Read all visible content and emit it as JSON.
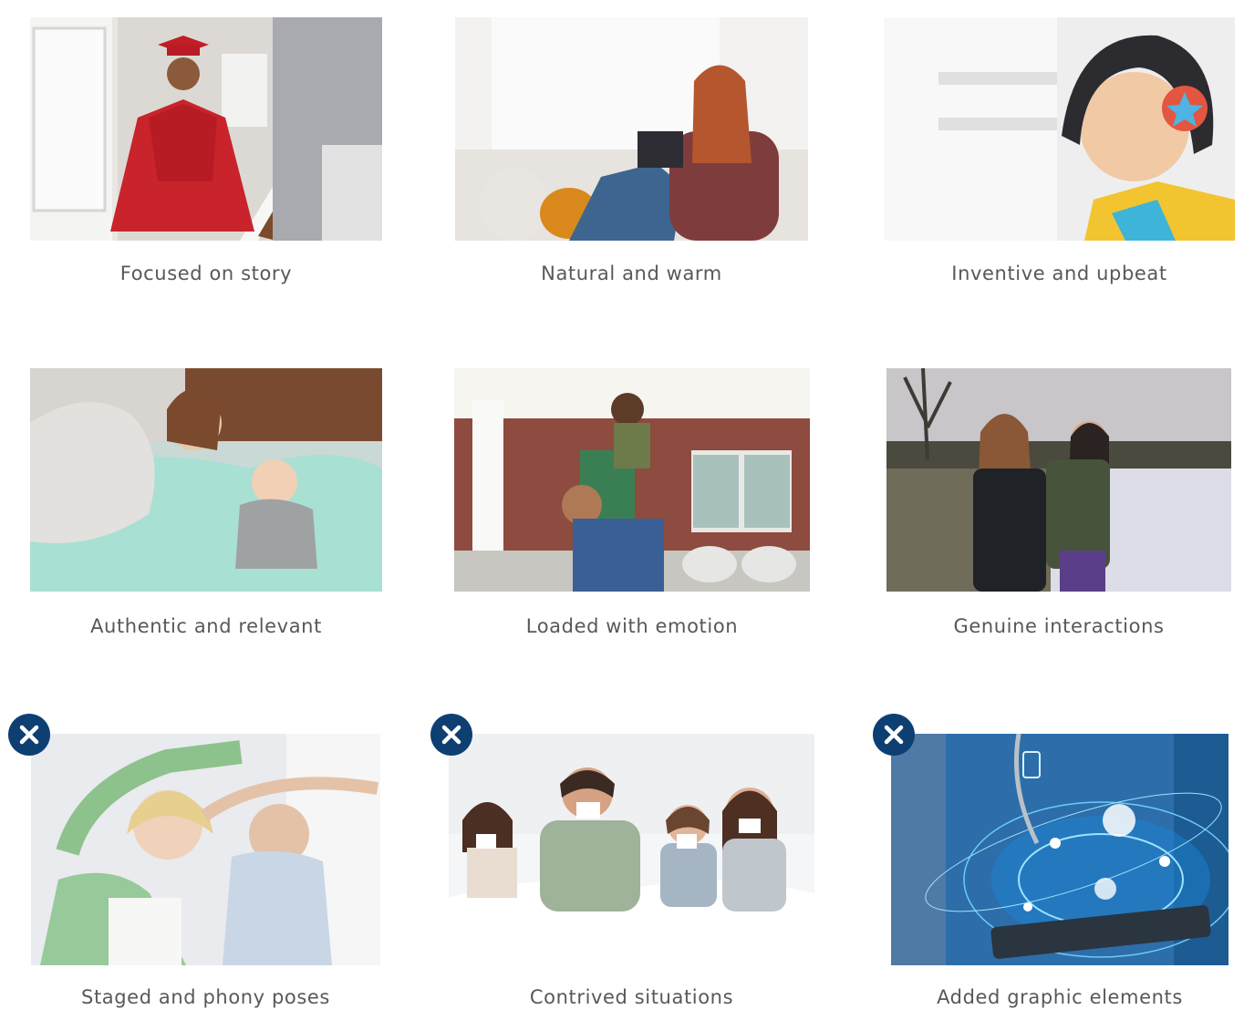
{
  "colors": {
    "caption_text": "#58585a",
    "badge_background": "#0d3f73",
    "badge_icon": "#ffffff"
  },
  "cards": [
    {
      "caption": "Focused on story",
      "icon": null
    },
    {
      "caption": "Natural and warm",
      "icon": null
    },
    {
      "caption": "Inventive and upbeat",
      "icon": null
    },
    {
      "caption": "Authentic and relevant",
      "icon": null
    },
    {
      "caption": "Loaded with emotion",
      "icon": null
    },
    {
      "caption": "Genuine interactions",
      "icon": null
    },
    {
      "caption": "Staged and phony poses",
      "icon": "close-icon"
    },
    {
      "caption": "Contrived situations",
      "icon": "close-icon"
    },
    {
      "caption": "Added graphic elements",
      "icon": "close-icon"
    }
  ]
}
